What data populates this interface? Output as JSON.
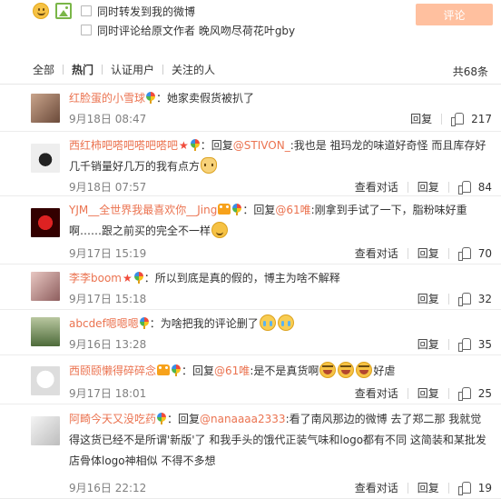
{
  "composer": {
    "icons": [
      "emoji-icon",
      "image-icon"
    ],
    "option_repost": "同时转发到我的微博",
    "option_comment_author": "同时评论给原文作者 晚风吻尽荷花叶gby",
    "submit_label": "评论"
  },
  "tabs": {
    "items": [
      "全部",
      "热门",
      "认证用户",
      "关注的人"
    ],
    "active": "热门",
    "total": "共68条"
  },
  "actions": {
    "view_dialog": "查看对话",
    "reply": "回复"
  },
  "comments": [
    {
      "user": "红脸蛋的小雪球",
      "badges": [
        "badge-icon"
      ],
      "text_parts": [
        {
          "t": "：她家卖假货被扒了"
        }
      ],
      "time": "9月18日 08:47",
      "has_dialog": false,
      "likes": "217"
    },
    {
      "user": "西红柿吧嗒吧嗒吧嗒吧",
      "badges": [
        "star-icon",
        "badge-icon"
      ],
      "text_parts": [
        {
          "t": "：回复"
        },
        {
          "m": "@STIVON_"
        },
        {
          "t": ":我也是 祖玛龙的味道好奇怪 而且库存好几千销量好几万的我有点方"
        },
        {
          "e": "cat"
        }
      ],
      "time": "9月18日 07:57",
      "has_dialog": true,
      "likes": "84"
    },
    {
      "user": "YJM__全世界我最喜欢你__Jing",
      "badges": [
        "crown-icon",
        "badge-icon"
      ],
      "text_parts": [
        {
          "t": "：回复"
        },
        {
          "m": "@61唯"
        },
        {
          "t": ":刚拿到手试了一下，脂粉味好重啊……跟之前买的完全不一样"
        },
        {
          "e": "grin"
        }
      ],
      "time": "9月17日 15:19",
      "has_dialog": true,
      "likes": "70"
    },
    {
      "user": "李李boom",
      "badges": [
        "star-icon",
        "badge-icon"
      ],
      "text_parts": [
        {
          "t": "：所以到底是真的假的，博主为啥不解释"
        }
      ],
      "time": "9月17日 15:18",
      "has_dialog": false,
      "likes": "32"
    },
    {
      "user": "abcdef嗯嗯嗯",
      "badges": [
        "badge-icon"
      ],
      "text_parts": [
        {
          "t": "：为啥把我的评论删了"
        },
        {
          "e": "cry"
        },
        {
          "e": "cry"
        }
      ],
      "time": "9月16日 13:28",
      "has_dialog": false,
      "likes": "35"
    },
    {
      "user": "西颐颐懒得碎碎念",
      "badges": [
        "crown-icon",
        "badge-icon"
      ],
      "text_parts": [
        {
          "t": "：回复"
        },
        {
          "m": "@61唯"
        },
        {
          "t": ":是不是真货啊"
        },
        {
          "e": "laugh"
        },
        {
          "e": "laugh"
        },
        {
          "e": "laugh"
        },
        {
          "t": "好虐"
        }
      ],
      "time": "9月17日 18:01",
      "has_dialog": true,
      "likes": "25"
    },
    {
      "user": "阿畸今天又没吃药",
      "badges": [
        "badge-icon"
      ],
      "text_parts": [
        {
          "t": "：回复"
        },
        {
          "m": "@nanaaaa2333"
        },
        {
          "t": ":看了南风那边的微博 去了郑二那 我就觉得这货已经不是所谓'新版'了 和我手头的饿代正装气味和logo都有不同 这简装和某批发店骨体logo神相似 不得不多想"
        }
      ],
      "time": "9月16日 22:12",
      "has_dialog": true,
      "likes": "19"
    }
  ]
}
